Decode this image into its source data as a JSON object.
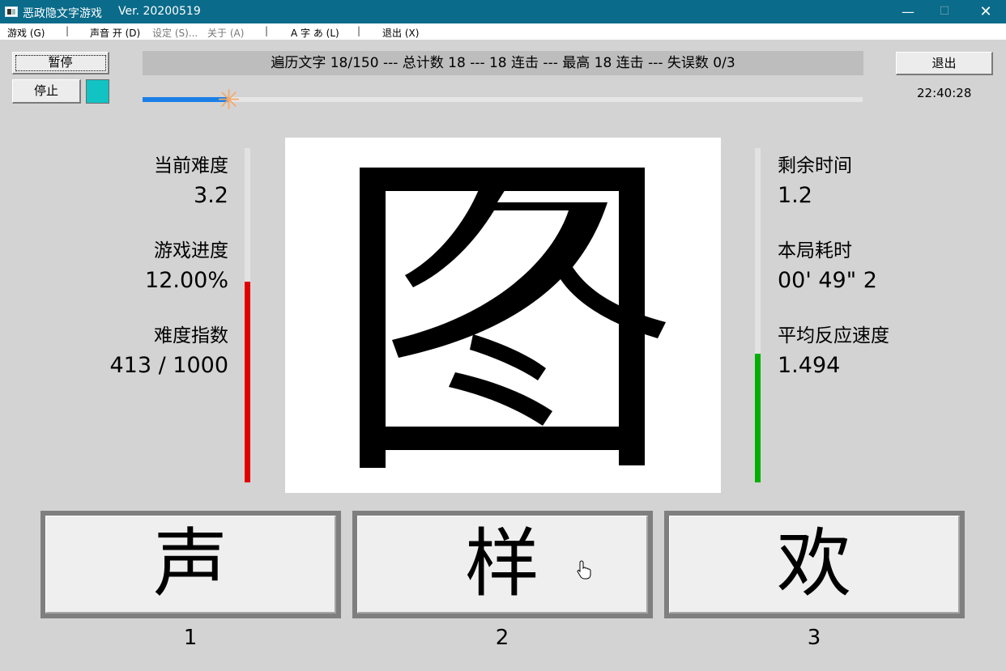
{
  "window": {
    "title": "恶政隐文字游戏",
    "version": "Ver. 20200519",
    "controls": {
      "minimize": "—",
      "maximize": "☐",
      "close": "✕"
    }
  },
  "menu": [
    {
      "label": "游戏 (G)",
      "enabled": true
    },
    {
      "label": "声音 开 (D)",
      "enabled": true
    },
    {
      "label": "设定 (S)...",
      "enabled": false
    },
    {
      "label": "关于 (A)",
      "enabled": false
    },
    {
      "label": "A 字 あ (L)",
      "enabled": true
    },
    {
      "label": "退出 (X)",
      "enabled": true
    }
  ],
  "menu_separator": "|",
  "controls": {
    "pause_label": "暂停",
    "stop_label": "停止",
    "exit_label": "退出",
    "swatch_color": "#12c3c3"
  },
  "status_banner": "遍历文字 18/150 --- 总计数 18 --- 18 连击 --- 最高 18 连击 --- 失误数 0/3",
  "progress": {
    "value": 0.12,
    "marker_symbol": "✳",
    "color": "#1a7fe6"
  },
  "clock": "22:40:28",
  "left_stats": [
    {
      "label": "当前难度",
      "value": "3.2"
    },
    {
      "label": "游戏进度",
      "value": "12.00%"
    },
    {
      "label": "难度指数",
      "value": "413 / 1000"
    }
  ],
  "right_stats": [
    {
      "label": "剩余时间",
      "value": "1.2"
    },
    {
      "label": "本局耗时",
      "value": "00' 49\" 2"
    },
    {
      "label": "平均反应速度",
      "value": "1.494"
    }
  ],
  "left_meter": {
    "level": 0.6,
    "color": "#e00000"
  },
  "right_meter": {
    "level": 0.385,
    "color": "#00b000"
  },
  "answers": [
    {
      "char": "声",
      "number": "1"
    },
    {
      "char": "样",
      "number": "2"
    },
    {
      "char": "欢",
      "number": "3"
    }
  ],
  "cursor_icon": "hand-pointer-icon"
}
